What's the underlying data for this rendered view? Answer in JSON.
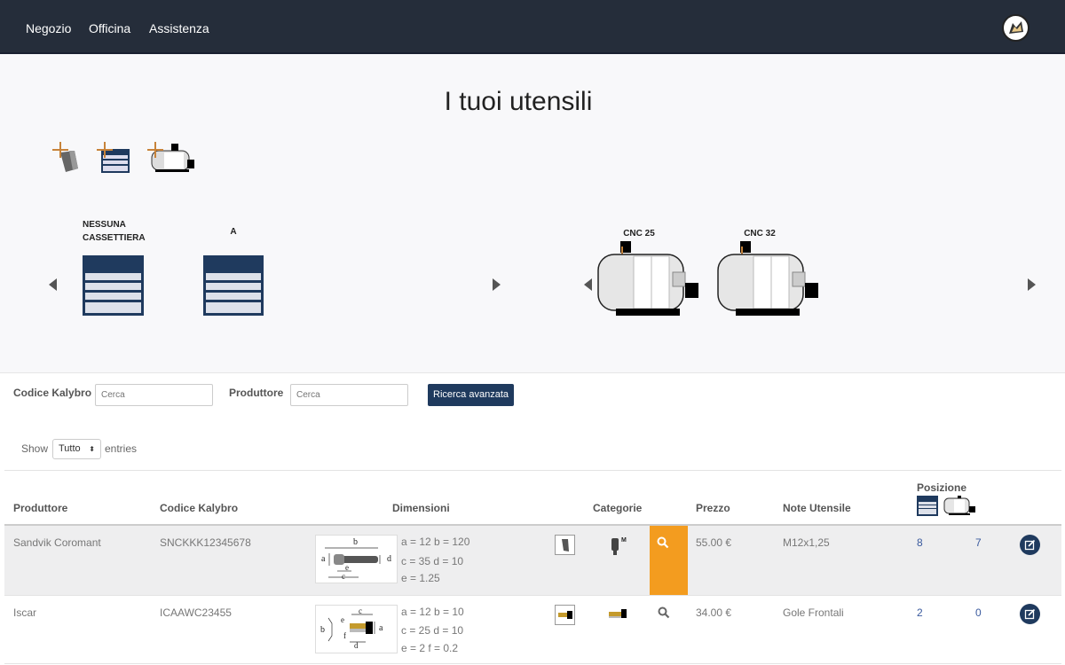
{
  "nav": {
    "items": [
      "Negozio",
      "Officina",
      "Assistenza"
    ],
    "logo_icon": "wolf-logo-icon"
  },
  "hero": {
    "title": "I tuoi utensili",
    "add_buttons": [
      "add-tool-icon",
      "add-cabinet-icon",
      "add-machine-icon"
    ],
    "cabinets": [
      {
        "label": "NESSUNA CASSETTIERA"
      },
      {
        "label": "A"
      }
    ],
    "machines": [
      {
        "label": "CNC 25"
      },
      {
        "label": "CNC 32"
      }
    ]
  },
  "filters": {
    "code_label": "Codice Kalybro",
    "code_placeholder": "Cerca",
    "maker_label": "Produttore",
    "maker_placeholder": "Cerca",
    "advanced_button": "Ricerca avanzata"
  },
  "entries": {
    "show": "Show",
    "selected": "Tutto",
    "suffix": "entries"
  },
  "table": {
    "headers": {
      "produttore": "Produttore",
      "codice": "Codice Kalybro",
      "dimensioni": "Dimensioni",
      "categorie": "Categorie",
      "prezzo": "Prezzo",
      "note": "Note Utensile",
      "posizione": "Posizione"
    },
    "rows": [
      {
        "produttore": "Sandvik Coromant",
        "codice": "SNCKKK12345678",
        "dim_line1": "a = 12 b = 120",
        "dim_line2": "c = 35 d = 10",
        "dim_line3": "e = 1.25",
        "prezzo": "55.00 €",
        "note": "M12x1,25",
        "pos_cabinet": "8",
        "pos_machine": "7",
        "diagram": {
          "b": "b",
          "a": "a",
          "d": "d",
          "e": "e",
          "c": "c"
        }
      },
      {
        "produttore": "Iscar",
        "codice": "ICAAWC23455",
        "dim_line1": "a = 12 b = 10",
        "dim_line2": "c = 25 d = 10",
        "dim_line3": "e = 2 f = 0.2",
        "prezzo": "34.00 €",
        "note": "Gole Frontali",
        "pos_cabinet": "2",
        "pos_machine": "0",
        "diagram": {
          "c": "c",
          "b": "b",
          "e": "e",
          "f": "f",
          "a": "a",
          "d": "d"
        }
      }
    ]
  },
  "colors": {
    "navbar": "#252d3a",
    "accent": "#1f3a5e",
    "highlight": "#f39c1f",
    "link": "#3a5a9e"
  }
}
